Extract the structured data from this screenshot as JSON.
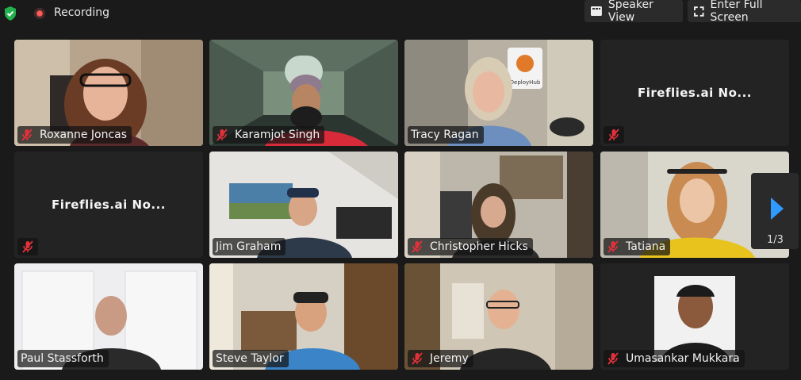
{
  "topbar": {
    "recording_label": "Recording",
    "speaker_view_label": "Speaker View",
    "full_screen_label": "Enter Full Screen"
  },
  "participants": [
    {
      "name": "Roxanne Joncas"
    },
    {
      "name": "Karamjot Singh"
    },
    {
      "name": "Tracy Ragan"
    },
    {
      "name": "Fireflies.ai No..."
    },
    {
      "name": "Fireflies.ai No..."
    },
    {
      "name": "Jim Graham"
    },
    {
      "name": "Christopher Hicks"
    },
    {
      "name": "Tatiana"
    },
    {
      "name": "Paul Stassforth"
    },
    {
      "name": "Steve Taylor"
    },
    {
      "name": "Jeremy"
    },
    {
      "name": "Umasankar Mukkara"
    }
  ],
  "tracy_sign": "DeployHub",
  "pager": {
    "page": "1/3"
  },
  "colors": {
    "active_speaker": "#23d959",
    "recording": "#e9474b",
    "muted": "#e0313a"
  }
}
